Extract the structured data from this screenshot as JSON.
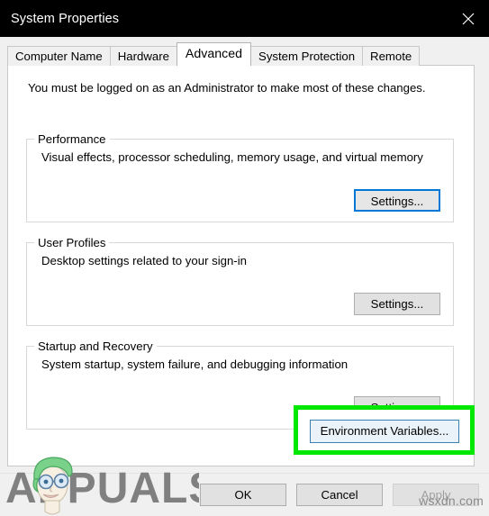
{
  "window": {
    "title": "System Properties",
    "close_icon": "close-icon",
    "titlebar_color": "#000000",
    "titlebar_text_color": "#ffffff"
  },
  "tabs": [
    {
      "label": "Computer Name",
      "selected": false
    },
    {
      "label": "Hardware",
      "selected": false
    },
    {
      "label": "Advanced",
      "selected": true
    },
    {
      "label": "System Protection",
      "selected": false
    },
    {
      "label": "Remote",
      "selected": false
    }
  ],
  "page": {
    "admin_note": "You must be logged on as an Administrator to make most of these changes.",
    "groups": [
      {
        "title": "Performance",
        "description": "Visual effects, processor scheduling, memory usage, and virtual memory",
        "button_label": "Settings...",
        "button_focused": true
      },
      {
        "title": "User Profiles",
        "description": "Desktop settings related to your sign-in",
        "button_label": "Settings...",
        "button_focused": false
      },
      {
        "title": "Startup and Recovery",
        "description": "System startup, system failure, and debugging information",
        "button_label": "Settings...",
        "button_focused": false
      }
    ],
    "environment_variables_button": {
      "label": "Environment Variables...",
      "highlight_color": "#00e800",
      "border_color": "#3c7fb1",
      "fill_color": "#eaf2fa"
    }
  },
  "footer": {
    "ok_label": "OK",
    "cancel_label": "Cancel",
    "apply_label": "Apply",
    "apply_disabled": true
  },
  "watermarks": {
    "brand_text": "APPUALS",
    "site_text": "wsxdn.com",
    "brand_color": "#808080"
  }
}
